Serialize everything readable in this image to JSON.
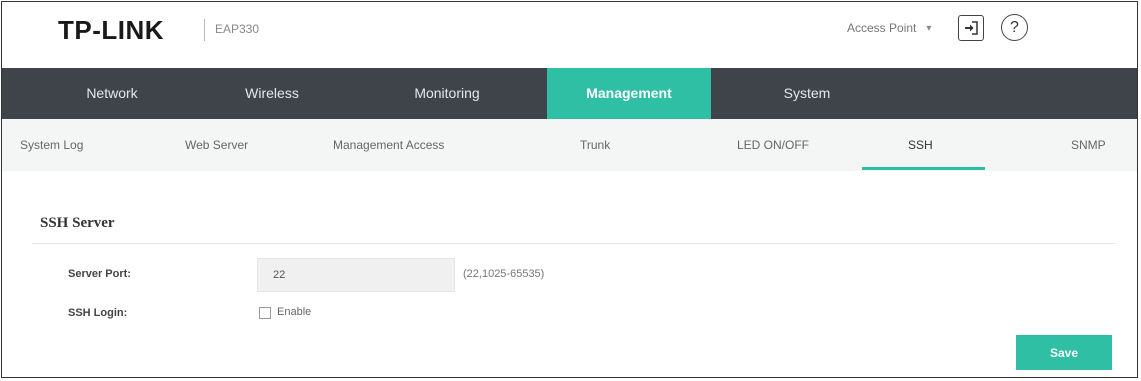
{
  "header": {
    "logo": "TP-LINK",
    "model": "EAP330",
    "mode": "Access Point",
    "mode_icon": "chevron-down-icon",
    "logout_icon": "logout-icon",
    "help_label": "?"
  },
  "main_nav": {
    "tabs": [
      {
        "label": "Network",
        "active": false
      },
      {
        "label": "Wireless",
        "active": false
      },
      {
        "label": "Monitoring",
        "active": false
      },
      {
        "label": "Management",
        "active": true
      },
      {
        "label": "System",
        "active": false
      }
    ]
  },
  "sub_nav": {
    "tabs": [
      {
        "label": "System Log",
        "active": false
      },
      {
        "label": "Web Server",
        "active": false
      },
      {
        "label": "Management Access",
        "active": false
      },
      {
        "label": "Trunk",
        "active": false
      },
      {
        "label": "LED ON/OFF",
        "active": false
      },
      {
        "label": "SSH",
        "active": true
      },
      {
        "label": "SNMP",
        "active": false
      }
    ]
  },
  "ssh_server": {
    "title": "SSH Server",
    "server_port_label": "Server Port:",
    "server_port_value": "22",
    "server_port_hint": "(22,1025-65535)",
    "ssh_login_label": "SSH Login:",
    "ssh_login_enable_label": "Enable",
    "ssh_login_enabled": false
  },
  "actions": {
    "save_label": "Save"
  },
  "colors": {
    "accent": "#2ebfa5",
    "nav_background": "#3e4449",
    "subnav_background": "#f4f5f5"
  }
}
